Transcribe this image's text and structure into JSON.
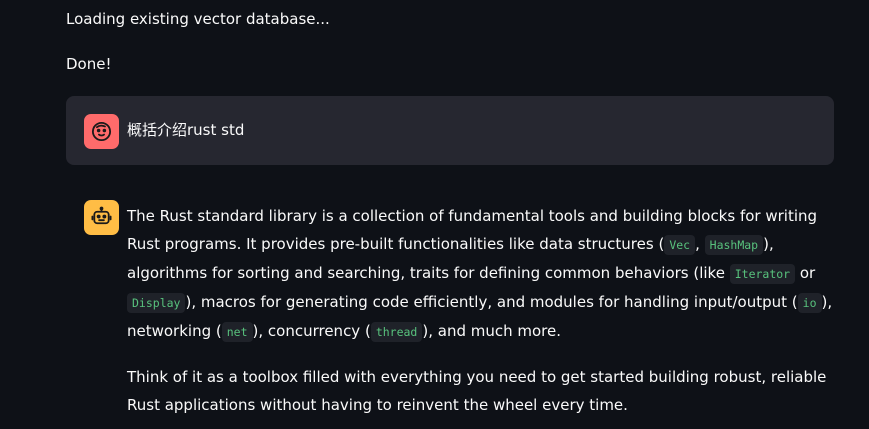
{
  "status": {
    "loading": "Loading existing vector database...",
    "done": "Done!"
  },
  "user_message": {
    "avatar_icon": "face-icon",
    "text": "概括介绍rust std"
  },
  "assistant_message": {
    "avatar_icon": "robot-icon",
    "p1": {
      "t1": "The Rust standard library is a collection of fundamental tools and building blocks for writing Rust programs. It provides pre-built functionalities like data structures (",
      "c1": "Vec",
      "t2": ", ",
      "c2": "HashMap",
      "t3": "), algorithms for sorting and searching, traits for defining common behaviors (like ",
      "c3": "Iterator",
      "t4": " or ",
      "c4": "Display",
      "t5": "), macros for generating code efficiently, and modules for handling input/output (",
      "c5": "io",
      "t6": "), networking (",
      "c6": "net",
      "t7": "), concurrency (",
      "c7": "thread",
      "t8": "), and much more."
    },
    "p2": "Think of it as a toolbox filled with everything you need to get started building robust, reliable Rust applications without having to reinvent the wheel every time."
  },
  "colors": {
    "background": "#0e1117",
    "user_bubble": "#262730",
    "user_avatar": "#ff6b6b",
    "assistant_avatar": "#ffbd45",
    "code_text": "#58c27d"
  }
}
